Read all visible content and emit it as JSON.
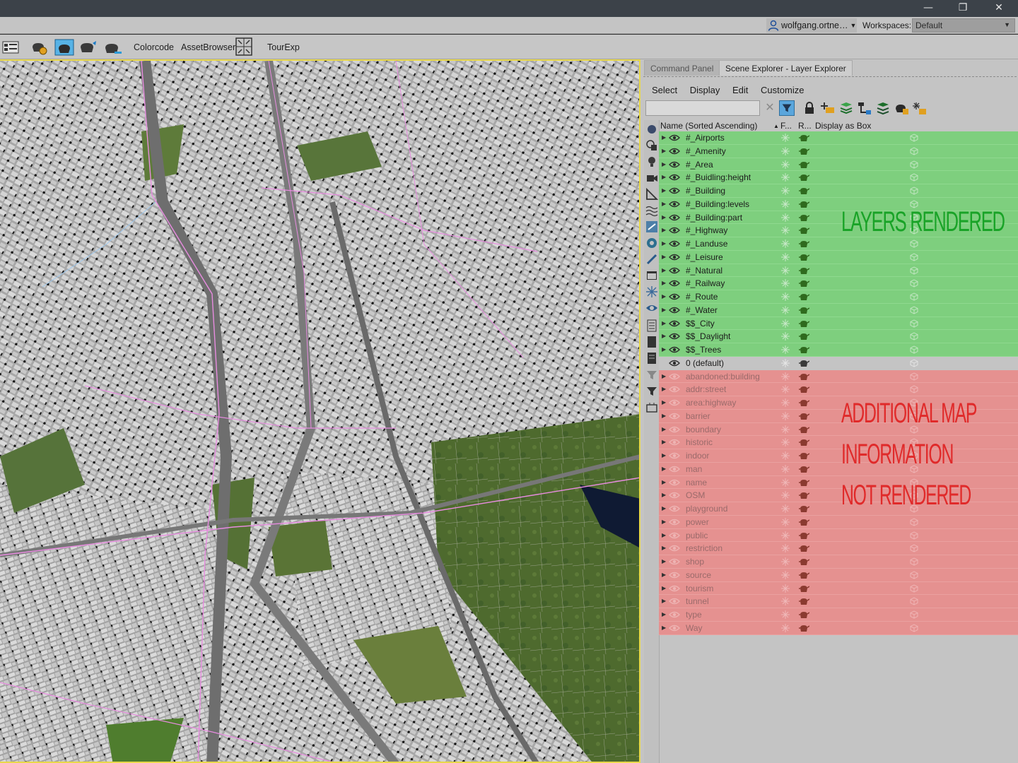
{
  "window": {
    "controls": {
      "minimize": "—",
      "restore": "❐",
      "close": "✕"
    }
  },
  "account": {
    "user": "wolfgang.ortne…",
    "workspaces_label": "Workspaces:",
    "workspace_value": "Default"
  },
  "toolbar": {
    "items": [
      "Colorcode",
      "AssetBrowser",
      "TourExp"
    ]
  },
  "panel": {
    "tabs": [
      "Command Panel",
      "Scene Explorer - Layer Explorer"
    ],
    "menus": [
      "Select",
      "Display",
      "Edit",
      "Customize"
    ],
    "search_placeholder": "",
    "columns": {
      "name": "Name (Sorted Ascending)",
      "sort_arrow": "▲",
      "frozen": "F...",
      "renderable": "R...",
      "display_as_box": "Display as Box"
    },
    "rendered_layers": [
      "#_Airports",
      "#_Amenity",
      "#_Area",
      "#_Buidling:height",
      "#_Building",
      "#_Building:levels",
      "#_Building:part",
      "#_Highway",
      "#_Landuse",
      "#_Leisure",
      "#_Natural",
      "#_Railway",
      "#_Route",
      "#_Water",
      "$$_City",
      "$$_Daylight",
      "$$_Trees"
    ],
    "default_layer": "0 (default)",
    "unrendered_layers": [
      "abandoned:building",
      "addr:street",
      "area:highway",
      "barrier",
      "boundary",
      "historic",
      "indoor",
      "man",
      "name",
      "OSM",
      "playground",
      "power",
      "public",
      "restriction",
      "shop",
      "source",
      "tourism",
      "tunnel",
      "type",
      "Way"
    ]
  },
  "annotations": {
    "rendered": "LAYERS RENDERED",
    "not_rendered": [
      "ADDITIONAL MAP",
      "INFORMATION",
      "NOT RENDERED"
    ]
  },
  "colors": {
    "rendered_bg": "#7ecf7e",
    "not_rendered_bg": "#e59190",
    "rendered_text": "#19a327",
    "not_rendered_text": "#e02a2a",
    "viewport_border": "#e8d84a"
  }
}
